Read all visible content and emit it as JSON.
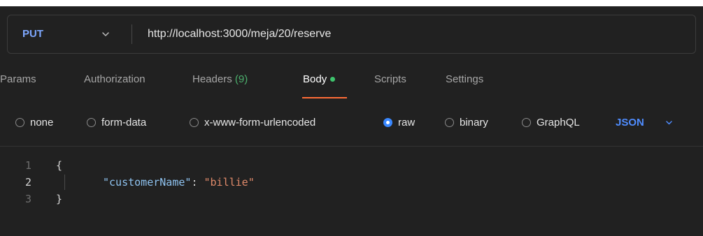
{
  "request": {
    "method": "PUT",
    "url": "http://localhost:3000/meja/20/reserve"
  },
  "tabs": [
    {
      "label": "Params"
    },
    {
      "label": "Authorization"
    },
    {
      "label": "Headers",
      "count": "(9)"
    },
    {
      "label": "Body",
      "active": true
    },
    {
      "label": "Scripts"
    },
    {
      "label": "Settings"
    }
  ],
  "body_options": {
    "none": "none",
    "form_data": "form-data",
    "urlencoded": "x-www-form-urlencoded",
    "raw": "raw",
    "binary": "binary",
    "graphql": "GraphQL",
    "selected": "raw",
    "language": "JSON"
  },
  "editor": {
    "lines": [
      {
        "num": "1",
        "open": "{"
      },
      {
        "num": "2",
        "key": "\"customerName\"",
        "colon": ": ",
        "value": "\"billie\""
      },
      {
        "num": "3",
        "close": "}"
      }
    ]
  },
  "colors": {
    "method": "#7ea8ff",
    "active_tab_underline": "#ff6c37",
    "body_dot": "#3ec46d",
    "language": "#4f8cff",
    "json_key": "#8fc3f0",
    "json_string": "#e08a6a"
  },
  "icons": {
    "method_dropdown": "chevron-down-icon",
    "language_dropdown": "chevron-down-icon"
  }
}
